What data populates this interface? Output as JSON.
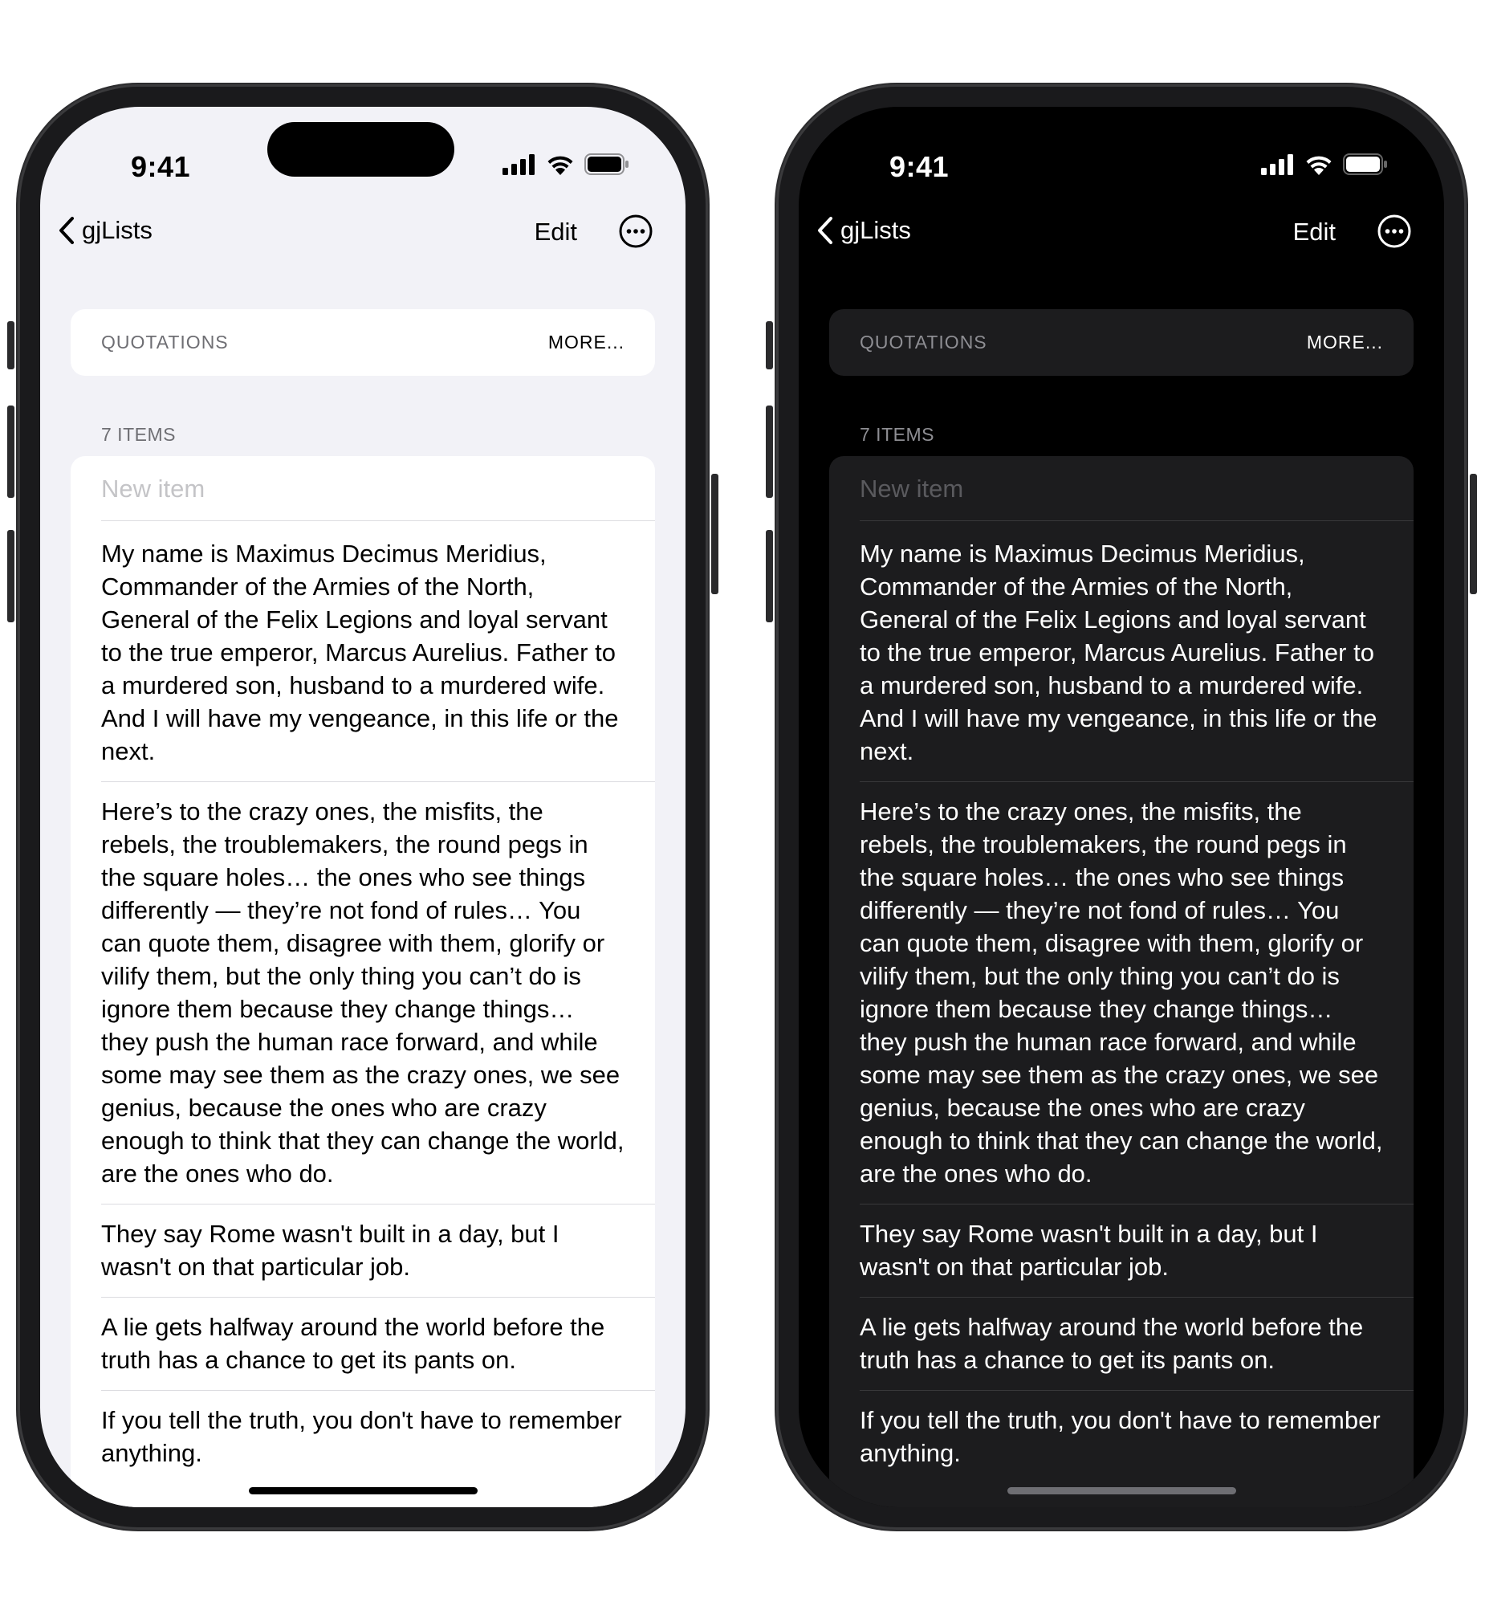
{
  "status": {
    "time": "9:41"
  },
  "nav": {
    "back_label": "gjLists",
    "edit_label": "Edit"
  },
  "header": {
    "title": "QUOTATIONS",
    "more_label": "MORE..."
  },
  "list": {
    "count_label": "7 ITEMS",
    "new_item_placeholder": "New item",
    "items": [
      "My name is Maximus Decimus Meridius, Commander of the Armies of the North, General of the Felix Legions and loyal servant to the true emperor, Marcus Aurelius. Father to a murdered son, husband to a murdered wife. And I will have my vengeance, in this life or the next.",
      "Here’s to the crazy ones, the misfits, the rebels, the troublemakers, the round pegs in the square holes… the ones who see things differently — they’re not fond of rules… You can quote them, disagree with them, glorify or vilify them, but the only thing you can’t do is ignore them because they change things… they push the human race forward, and while some may see them as the crazy ones, we see genius, because the ones who are crazy enough to think that they can change the world, are the ones who do.",
      "They say Rome wasn't built in a day, but I wasn't on that particular job.",
      "A lie gets halfway around the world before the truth has a chance to get its pants on.",
      "If you tell the truth, you don't have to remember anything."
    ]
  },
  "colors": {
    "accent_light": "#000000",
    "accent_dark": "#ffffff",
    "dark_card": "#1c1c1e",
    "light_bg": "#f2f2f7"
  }
}
